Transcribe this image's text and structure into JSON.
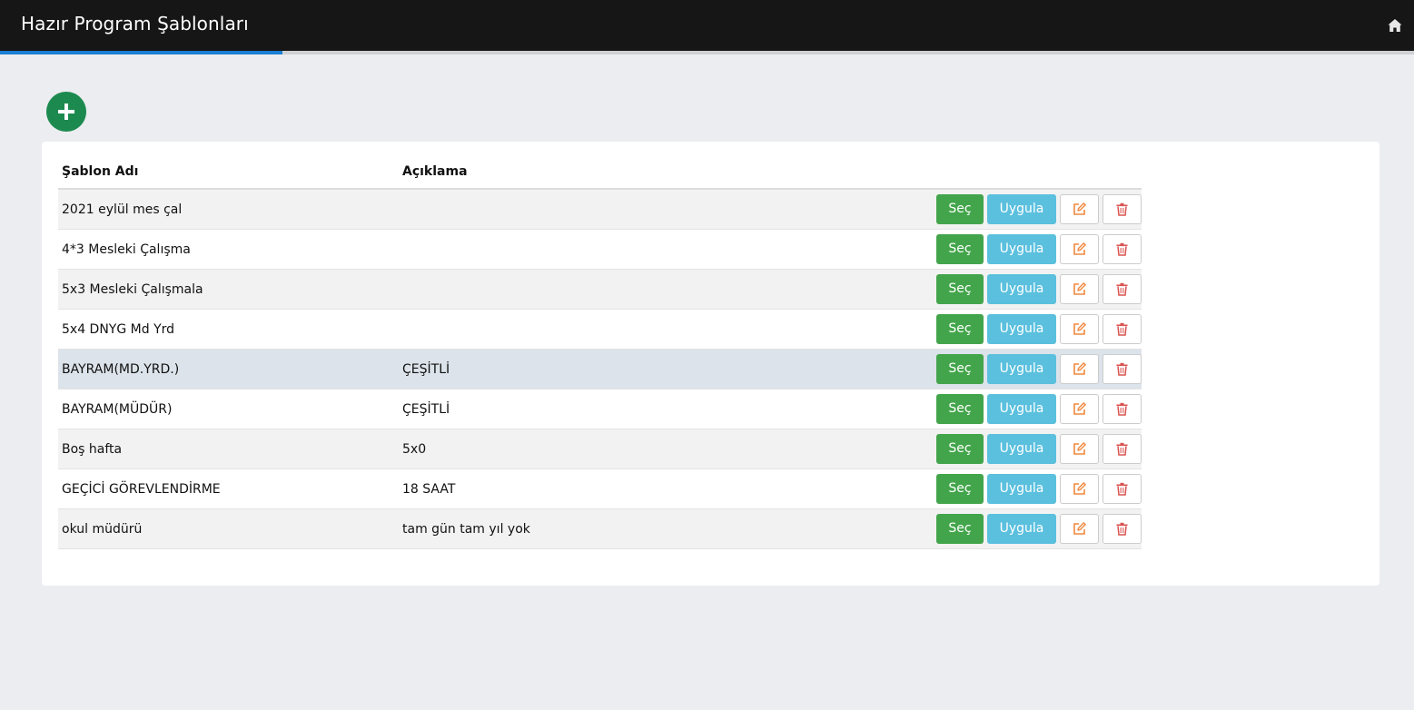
{
  "header": {
    "title": "Hazır Program Şablonları",
    "progress_percent": 20
  },
  "colors": {
    "topbar": "#161616",
    "progress": "#1a7fd2",
    "add_button": "#1c8a4f",
    "select_button": "#43a54b",
    "apply_button": "#5bc0de",
    "edit_icon": "#f0883e",
    "delete_icon": "#d9534f"
  },
  "icons": {
    "home": "home-icon",
    "add": "plus-icon",
    "edit": "edit-icon",
    "delete": "trash-icon"
  },
  "table": {
    "columns": [
      "Şablon Adı",
      "Açıklama"
    ],
    "rows": [
      {
        "name": "2021 eylül mes çal",
        "description": ""
      },
      {
        "name": "4*3 Mesleki Çalışma",
        "description": ""
      },
      {
        "name": "5x3 Mesleki Çalışmala",
        "description": ""
      },
      {
        "name": "5x4 DNYG Md Yrd",
        "description": ""
      },
      {
        "name": "BAYRAM(MD.YRD.)",
        "description": "ÇEŞİTLİ"
      },
      {
        "name": "BAYRAM(MÜDÜR)",
        "description": "ÇEŞİTLİ"
      },
      {
        "name": "Boş hafta",
        "description": "5x0"
      },
      {
        "name": "GEÇİCİ GÖREVLENDİRME",
        "description": "18 SAAT"
      },
      {
        "name": "okul müdürü",
        "description": "tam gün tam yıl yok"
      }
    ],
    "actions": {
      "select_label": "Seç",
      "apply_label": "Uygula"
    }
  }
}
